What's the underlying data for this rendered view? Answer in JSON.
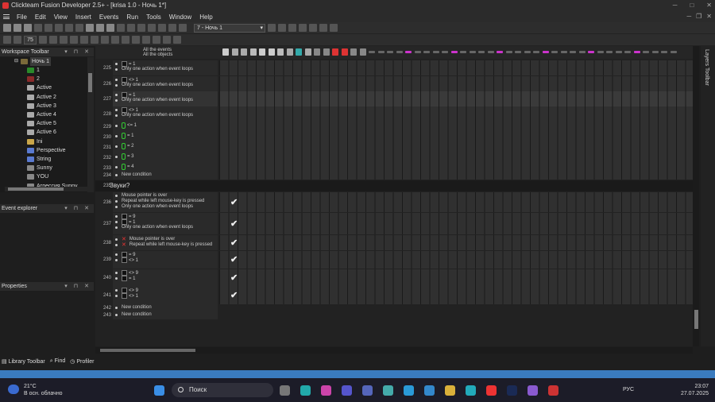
{
  "window": {
    "title": "Clickteam Fusion Developer 2.5+ - [krisa 1.0 - Ночь 1*]"
  },
  "menu": [
    "File",
    "Edit",
    "View",
    "Insert",
    "Events",
    "Run",
    "Tools",
    "Window",
    "Help"
  ],
  "toolbar": {
    "frame_selected": "7 - Ночь 1",
    "zoom": "75"
  },
  "workspace": {
    "title": "Workspace Toolbar",
    "root": "Ночь 1",
    "items": [
      {
        "label": "1",
        "color": "#2a8a2a"
      },
      {
        "label": "2",
        "color": "#8a2a2a"
      },
      {
        "label": "Active",
        "color": "#aaa"
      },
      {
        "label": "Active 2",
        "color": "#aaa"
      },
      {
        "label": "Active 3",
        "color": "#aaa"
      },
      {
        "label": "Active 4",
        "color": "#aaa"
      },
      {
        "label": "Active 5",
        "color": "#aaa"
      },
      {
        "label": "Active 6",
        "color": "#aaa"
      },
      {
        "label": "Ini",
        "color": "#c9a64a"
      },
      {
        "label": "Perspective",
        "color": "#5a7ad0"
      },
      {
        "label": "String",
        "color": "#5a7ad0"
      },
      {
        "label": "Sunny",
        "color": "#888"
      },
      {
        "label": "YOU",
        "color": "#888"
      },
      {
        "label": "Агрессия Sunny",
        "color": "#888"
      }
    ]
  },
  "event_explorer": {
    "title": "Event explorer"
  },
  "properties": {
    "title": "Properties"
  },
  "editor": {
    "header_line1": "All the events",
    "header_line2": "All the objects",
    "group_title": "Звуки?",
    "rows": [
      {
        "num": "225",
        "lines": [
          "= 1",
          "Only one action when event loops"
        ]
      },
      {
        "num": "226",
        "lines": [
          "<> 1",
          "Only one action when event loops"
        ]
      },
      {
        "num": "227",
        "lines": [
          "= 1",
          "Only one action when event loops"
        ]
      },
      {
        "num": "228",
        "lines": [
          "<> 1",
          "Only one action when event loops"
        ]
      },
      {
        "num": "229",
        "lines": [
          "<= 1"
        ]
      },
      {
        "num": "230",
        "lines": [
          "= 1"
        ]
      },
      {
        "num": "231",
        "lines": [
          "= 2"
        ]
      },
      {
        "num": "232",
        "lines": [
          "= 3"
        ]
      },
      {
        "num": "233",
        "lines": [
          "= 4"
        ]
      },
      {
        "num": "234",
        "lines": [
          "New condition"
        ]
      },
      {
        "num": "235",
        "lines": [
          "Звуки?"
        ]
      },
      {
        "num": "236",
        "lines": [
          "Mouse pointer is over",
          "Repeat while left mouse-key is pressed",
          "Only one action when event loops"
        ]
      },
      {
        "num": "237",
        "lines": [
          "= 9",
          "= 1",
          "Only one action when event loops"
        ]
      },
      {
        "num": "238",
        "lines": [
          "Mouse pointer is over",
          "Repeat while left mouse-key is pressed"
        ]
      },
      {
        "num": "239",
        "lines": [
          "= 9",
          "<> 1"
        ]
      },
      {
        "num": "240",
        "lines": [
          "<> 9",
          "= 1"
        ]
      },
      {
        "num": "241",
        "lines": [
          "<> 9",
          "<> 1"
        ]
      },
      {
        "num": "242",
        "lines": [
          "New condition"
        ]
      },
      {
        "num": "243",
        "lines": [
          "New condition"
        ]
      }
    ],
    "check": "✔"
  },
  "layers": {
    "title": "Layers Toolbar"
  },
  "bottom_tabs": [
    "Library Toolbar",
    "Find",
    "Profiler"
  ],
  "taskbar": {
    "weather_temp": "21°C",
    "weather_desc": "В осн. облачно",
    "search": "Поиск",
    "lang": "РУС",
    "time": "23:07",
    "date": "27.07.2025"
  }
}
